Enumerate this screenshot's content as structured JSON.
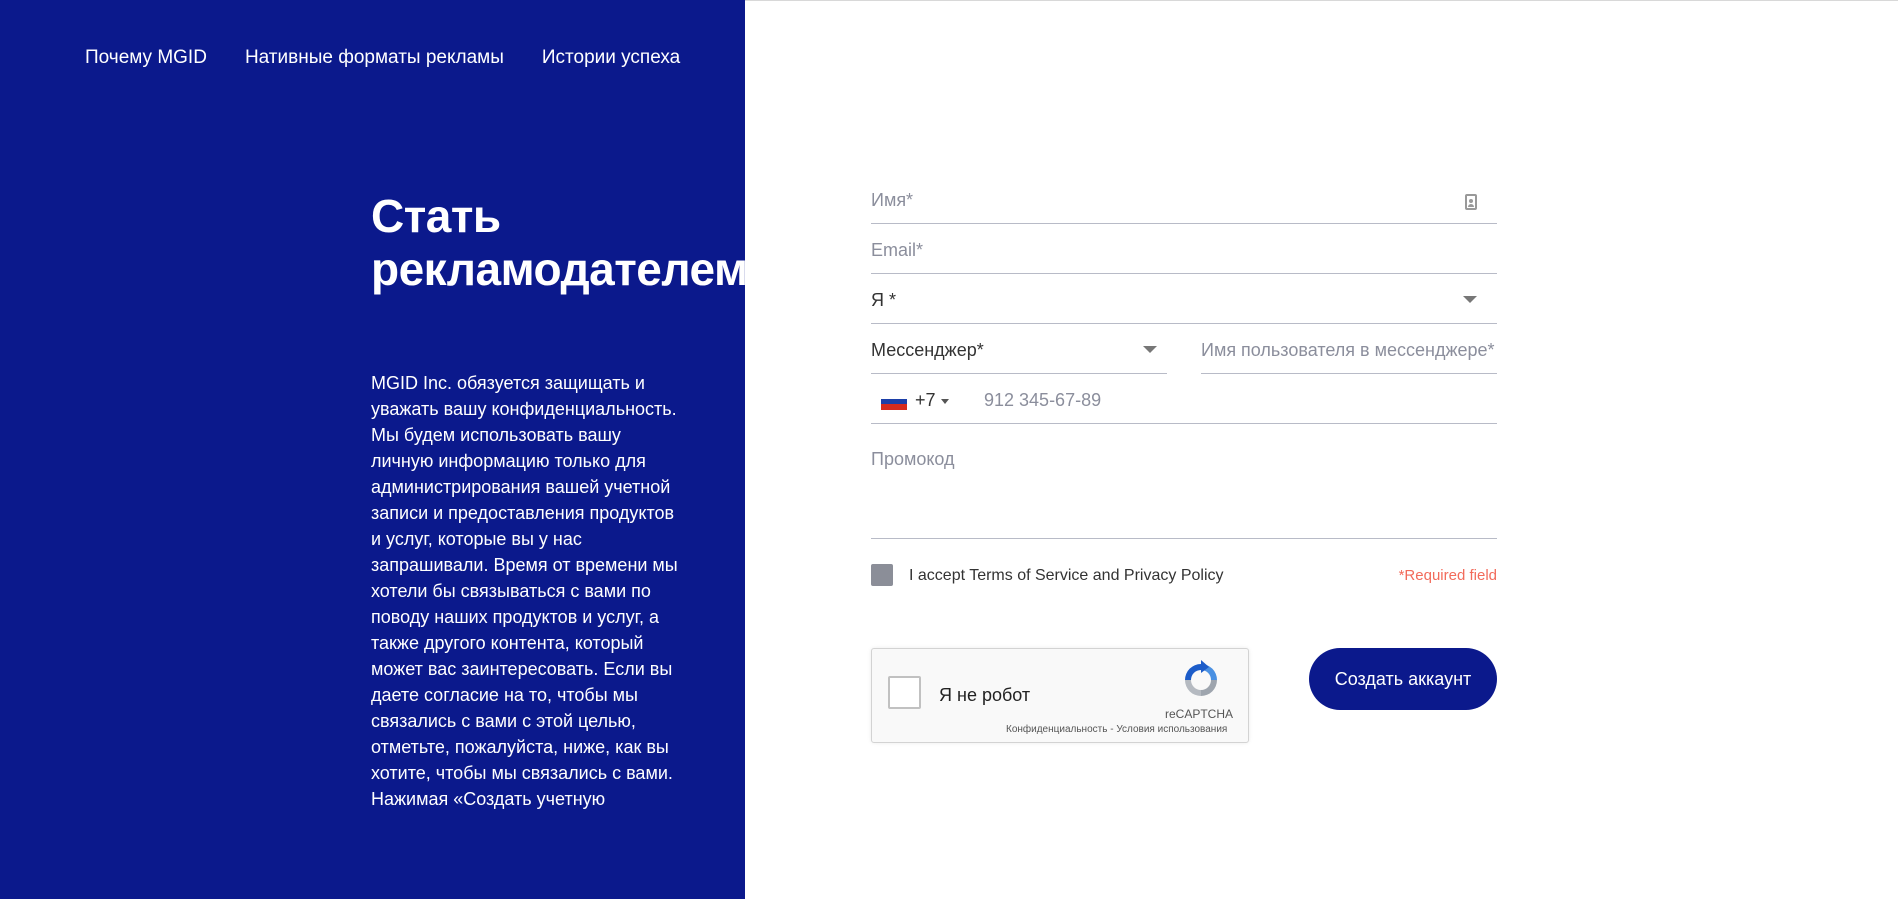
{
  "colors": {
    "brand_blue": "#0b198c",
    "required_red": "#f26b5b"
  },
  "nav": {
    "items": [
      {
        "label": "Почему MGID"
      },
      {
        "label": "Нативные форматы рекламы"
      },
      {
        "label": "Истории успеха"
      }
    ]
  },
  "hero": {
    "title_line1": "Стать",
    "title_line2": "рекламодателем",
    "privacy_text": "MGID Inc. обязуется защищать и уважать вашу конфиденциальность. Мы будем использовать вашу личную информацию только для администрирования вашей учетной записи и предоставления продуктов и услуг, которые вы у нас запрашивали. Время от времени мы хотели бы связываться с вами по поводу наших продуктов и услуг, а также другого контента, который может вас заинтересовать. Если вы даете согласие на то, чтобы мы связались с вами с этой целью, отметьте, пожалуйста, ниже, как вы хотите, чтобы мы связались с вами. Нажимая «Создать учетную"
  },
  "form": {
    "name": {
      "placeholder": "Имя*",
      "value": ""
    },
    "email": {
      "placeholder": "Email*",
      "value": ""
    },
    "role": {
      "label": "Я *",
      "options": []
    },
    "messenger": {
      "label": "Мессенджер*"
    },
    "messenger_username": {
      "placeholder": "Имя пользователя в мессенджере*",
      "value": ""
    },
    "phone": {
      "country_flag_colors": [
        "#ffffff",
        "#1c3fa8",
        "#d52b1e"
      ],
      "country_icon": "russia-flag-icon",
      "code": "+7",
      "placeholder": "912 345-67-89",
      "value": ""
    },
    "promo": {
      "placeholder": "Промокод",
      "value": ""
    },
    "terms": {
      "label": "I accept Terms of Service and Privacy Policy",
      "checked": false
    },
    "required_note": "*Required field",
    "recaptcha": {
      "label": "Я не робот",
      "brand": "reCAPTCHA",
      "privacy_link": "Конфиденциальность",
      "separator": " - ",
      "terms_link": "Условия использования"
    },
    "submit_label": "Создать аккаунт"
  }
}
